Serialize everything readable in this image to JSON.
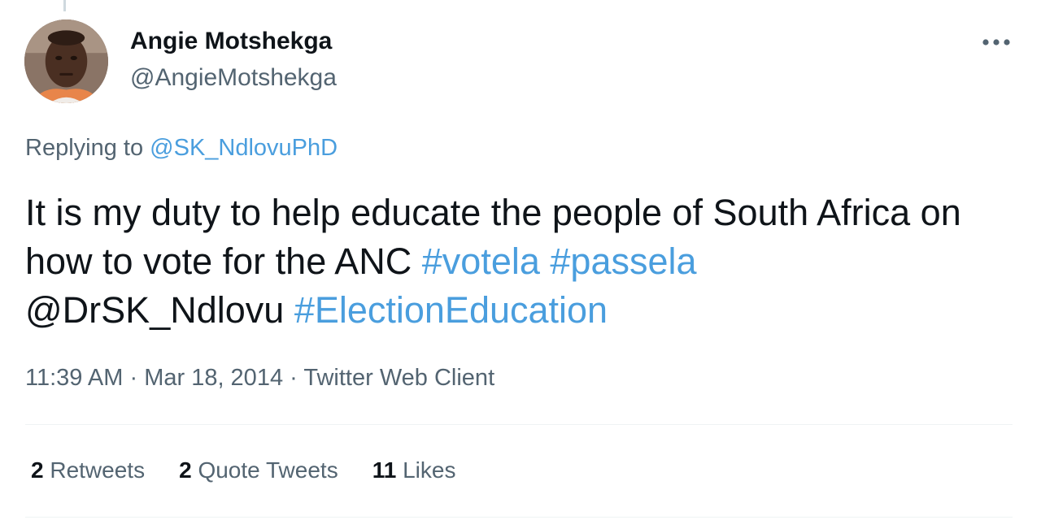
{
  "author": {
    "display_name": "Angie Motshekga",
    "handle": "@AngieMotshekga"
  },
  "reply": {
    "prefix": "Replying to",
    "to_handle": "@SK_NdlovuPhD"
  },
  "tweet": {
    "text_part1": "It is my duty to help educate the people of South Africa on how to vote for the ANC",
    "hashtag_1": "#votela",
    "hashtag_2": "#passela",
    "mention": "@DrSK_Ndlovu",
    "hashtag_3": "#ElectionEducation"
  },
  "meta": {
    "time": "11:39 AM",
    "separator": "·",
    "date": "Mar 18, 2014",
    "client": "Twitter Web Client"
  },
  "stats": {
    "retweets_count": "2",
    "retweets_label": "Retweets",
    "quotes_count": "2",
    "quotes_label": "Quote Tweets",
    "likes_count": "11",
    "likes_label": "Likes"
  },
  "colors": {
    "link": "#4a9ede",
    "secondary_text": "#536471",
    "primary_text": "#0f1419"
  },
  "icons": {
    "more": "more-horizontal-icon"
  }
}
